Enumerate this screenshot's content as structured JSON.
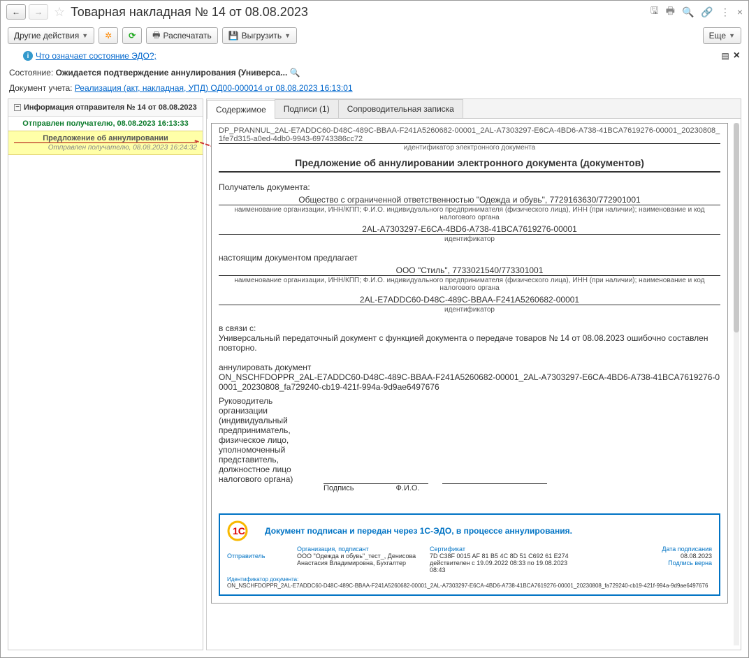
{
  "title": "Товарная накладная № 14 от 08.08.2023",
  "toolbar": {
    "other_actions": "Другие действия",
    "print": "Распечатать",
    "export": "Выгрузить",
    "more": "Еще"
  },
  "info_link": "Что означает состояние ЭДО?;",
  "status": {
    "label": "Состояние:",
    "value": "Ожидается подтверждение аннулирования (Универса..."
  },
  "doc_uchet": {
    "label": "Документ учета:",
    "link": "Реализация (акт, накладная, УПД) ОД00-000014 от 08.08.2023 16:13:01"
  },
  "sidebar": {
    "header": "Информация отправителя № 14 от 08.08.2023",
    "sent": "Отправлен получателю, 08.08.2023 16:13:33",
    "item_title": "Предложение об аннулировании",
    "item_sub": "Отправлен получателю, 08.08.2023 16:24:32"
  },
  "tabs": {
    "t1": "Содержимое",
    "t2": "Подписи (1)",
    "t3": "Сопроводительная записка"
  },
  "doc": {
    "id": "DP_PRANNUL_2AL-E7ADDC60-D48C-489C-BBAA-F241A5260682-00001_2AL-A7303297-E6CA-4BD6-A738-41BCA7619276-00001_20230808_1fe7d315-a0ed-4db0-9943-69743386cc72",
    "id_cap": "идентификатор электронного документа",
    "title": "Предложение об аннулировании электронного документа (документов)",
    "recipient_lbl": "Получатель документа:",
    "recipient_name": "Общество с ограниченной ответственностью \"Одежда и обувь\", 7729163630/772901001",
    "org_cap": "наименование организации, ИНН/КПП; Ф.И.О. индивидуального предпринимателя (физического лица), ИНН (при наличии); наименование и код налогового органа",
    "recipient_id": "2AL-A7303297-E6CA-4BD6-A738-41BCA7619276-00001",
    "id_cap2": "идентификатор",
    "proposes": "настоящим документом предлагает",
    "sender_name": "ООО \"Стиль\", 7733021540/773301001",
    "sender_id": "2AL-E7ADDC60-D48C-489C-BBAA-F241A5260682-00001",
    "in_connection": "в связи с:",
    "reason": "Универсальный передаточный документ с функцией документа о передаче товаров № 14 от 08.08.2023 ошибочно составлен повторно.",
    "cancel_lbl": "аннулировать документ",
    "cancel_doc": "ON_NSCHFDOPPR_2AL-E7ADDC60-D48C-489C-BBAA-F241A5260682-00001_2AL-A7303297-E6CA-4BD6-A738-41BCA7619276-00001_20230808_fa729240-cb19-421f-994a-9d9ae6497676",
    "head": "Руководитель организации (индивидуальный предприниматель, физическое лицо, уполномоченный представитель, должностное лицо налогового органа)",
    "sig": "Подпись",
    "fio": "Ф.И.О."
  },
  "stamp": {
    "head": "Документ подписан и передан через 1С-ЭДО, в процессе аннулирования.",
    "sender": "Отправитель",
    "org_lbl": "Организация, подписант",
    "org_val": "ООО \"Одежда и обувь\"_тест_, Денисова Анастасия Владимировна, Бухгалтер",
    "cert_lbl": "Сертификат",
    "cert_val": "7D C38F 0015 AF 81 B5 4C 8D 51 C692 61 E274 действителен с 19.09.2022 08:33 по 19.08.2023 08:43",
    "date_lbl": "Дата подписания",
    "date_val": "08.08.2023",
    "sign_ok": "Подпись верна",
    "doc_id_lbl": "Идентификатор документа:",
    "doc_id_val": "ON_NSCHFDOPPR_2AL-E7ADDC60-D48C-489C-BBAA-F241A5260682-00001_2AL-A7303297-E6CA-4BD6-A738-41BCA7619276-00001_20230808_fa729240-cb19-421f-994a-9d9ae6497676"
  }
}
